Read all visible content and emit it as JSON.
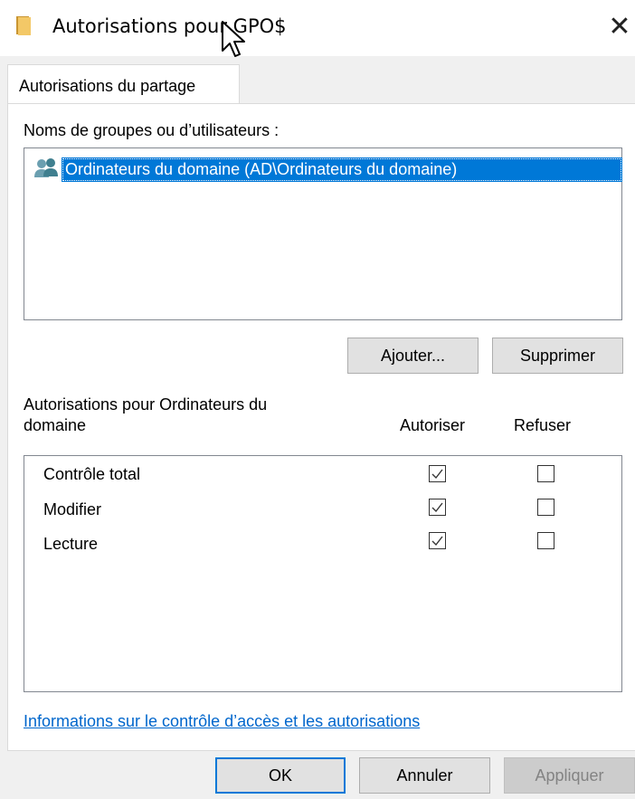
{
  "window": {
    "title": "Autorisations pour GPO$",
    "close_symbol": "✕",
    "folder_icon": "folder-icon"
  },
  "tabs": [
    {
      "label": "Autorisations du partage",
      "active": true
    }
  ],
  "groups": {
    "label": "Noms de groupes ou d’utilisateurs :",
    "items": [
      {
        "label": "Ordinateurs du domaine (AD\\Ordinateurs du domaine)",
        "icon": "group-users-icon",
        "selected": true
      }
    ],
    "add_button": "Ajouter...",
    "remove_button": "Supprimer"
  },
  "permissions": {
    "label_line1": "Autorisations pour Ordinateurs du",
    "label_line2": "domaine",
    "allow_header": "Autoriser",
    "deny_header": "Refuser",
    "rows": [
      {
        "name": "Contrôle total",
        "allow": true,
        "deny": false
      },
      {
        "name": "Modifier",
        "allow": true,
        "deny": false
      },
      {
        "name": "Lecture",
        "allow": true,
        "deny": false
      }
    ]
  },
  "link": "Informations sur le contrôle d’accès et les autorisations",
  "footer": {
    "ok": "OK",
    "cancel": "Annuler",
    "apply": "Appliquer"
  },
  "colors": {
    "accent": "#0078d7",
    "link": "#0066cc",
    "folder": "#e8b84a"
  }
}
